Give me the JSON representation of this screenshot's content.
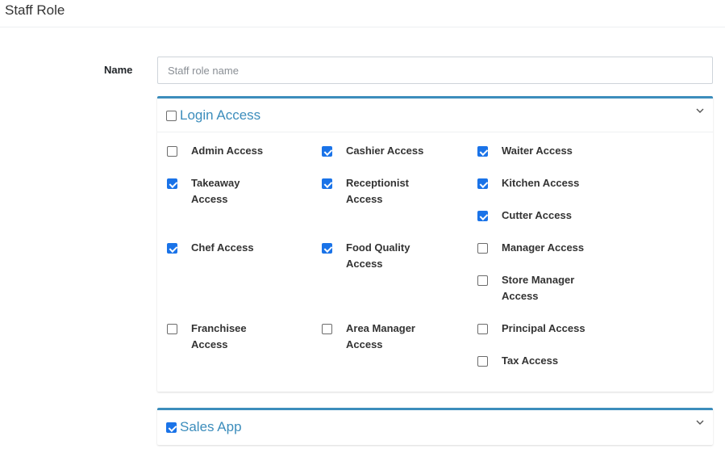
{
  "page": {
    "title": "Staff Role"
  },
  "form": {
    "name_label": "Name",
    "name_placeholder": "Staff role name",
    "name_value": ""
  },
  "login_card": {
    "title": "Login Access",
    "checked": false,
    "permissions": [
      {
        "label": "Admin Access",
        "checked": false
      },
      {
        "label": "Cashier Access",
        "checked": true
      },
      {
        "label": "Waiter Access",
        "checked": true
      },
      {
        "label": "Takeaway Access",
        "checked": true
      },
      {
        "label": "Receptionist Access",
        "checked": true
      },
      {
        "label": "Kitchen Access",
        "checked": true
      },
      {
        "label": "Cutter Access",
        "checked": true
      },
      {
        "label": "Chef Access",
        "checked": true
      },
      {
        "label": "Food Quality Access",
        "checked": true
      },
      {
        "label": "Manager Access",
        "checked": false
      },
      {
        "label": "Store Manager Access",
        "checked": false
      },
      {
        "label": "Franchisee Access",
        "checked": false
      },
      {
        "label": "Area Manager Access",
        "checked": false
      },
      {
        "label": "Principal Access",
        "checked": false
      },
      {
        "label": "Tax Access",
        "checked": false
      }
    ]
  },
  "sales_card": {
    "title": "Sales App",
    "checked": true
  },
  "colors": {
    "accent": "#3c8dbc",
    "checkbox": "#1a73e8"
  }
}
